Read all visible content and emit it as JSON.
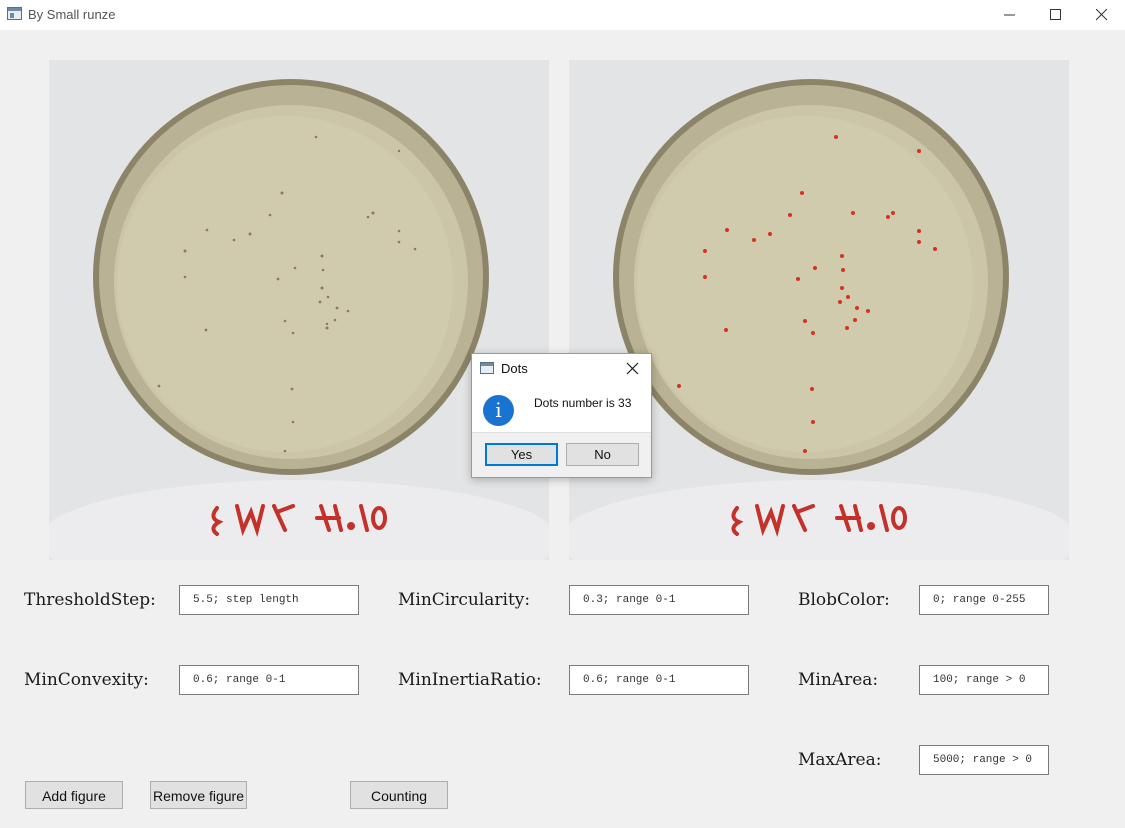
{
  "window": {
    "title": "By Small runze",
    "icon": "app-window-icon",
    "controls": [
      "minimize-icon",
      "maximize-icon",
      "close-icon"
    ]
  },
  "images": {
    "plate_label": "ε Wン 사.0l"
  },
  "form": {
    "threshold_step": {
      "label": "ThresholdStep:",
      "value": "5.5; step length"
    },
    "min_circularity": {
      "label": "MinCircularity:",
      "value": "0.3; range 0-1"
    },
    "blob_color": {
      "label": "BlobColor:",
      "value": "0; range 0-255"
    },
    "min_convexity": {
      "label": "MinConvexity:",
      "value": "0.6; range 0-1"
    },
    "min_inertia_ratio": {
      "label": "MinInertiaRatio:",
      "value": "0.6; range 0-1"
    },
    "min_area": {
      "label": "MinArea:",
      "value": "100; range > 0"
    },
    "max_area": {
      "label": "MaxArea:",
      "value": "5000; range > 0"
    }
  },
  "buttons": {
    "add_figure": "Add figure",
    "remove_figure": "Remove figure",
    "counting": "Counting"
  },
  "dialog": {
    "title": "Dots",
    "message": "Dots number is 33",
    "icon": "info-icon",
    "yes": "Yes",
    "no": "No"
  },
  "colors": {
    "accent": "#0078d7",
    "info_icon": "#1874d0",
    "detected_dot": "#d8321f"
  }
}
